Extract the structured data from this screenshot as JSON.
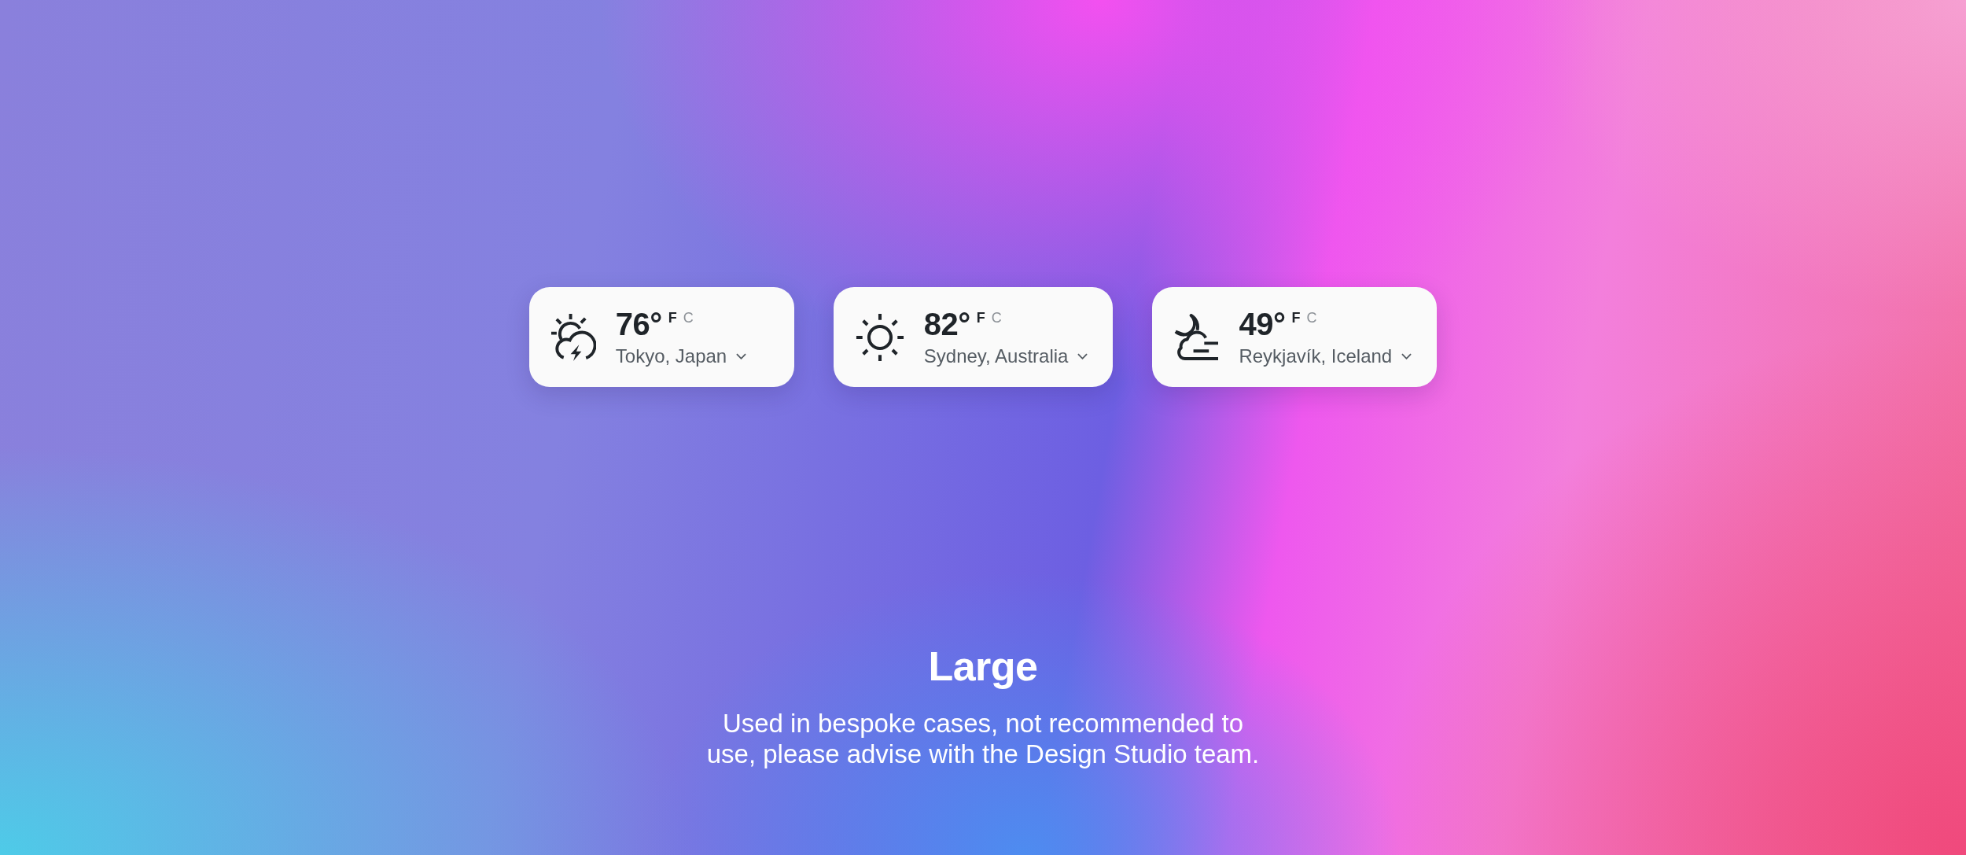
{
  "cards": [
    {
      "kind": "storm",
      "temperature": "76°",
      "units": [
        {
          "label": "F",
          "selected": true
        },
        {
          "label": "C",
          "selected": false
        }
      ],
      "location": "Tokyo, Japan"
    },
    {
      "kind": "sunny",
      "temperature": "82°",
      "units": [
        {
          "label": "F",
          "selected": true
        },
        {
          "label": "C",
          "selected": false
        }
      ],
      "location": "Sydney, Australia"
    },
    {
      "kind": "night",
      "temperature": "49°",
      "units": [
        {
          "label": "F",
          "selected": true
        },
        {
          "label": "C",
          "selected": false
        }
      ],
      "location": "Reykjavík, Iceland"
    }
  ],
  "caption": {
    "title": "Large",
    "description": "Used in bespoke cases, not recommended to use, please advise with the Design Studio team."
  }
}
